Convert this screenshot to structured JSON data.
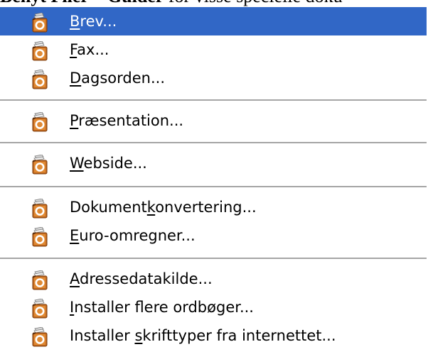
{
  "header_fragment": {
    "bold1": "Benyt",
    "bold2": "Filer",
    "dash": " – ",
    "bold3": "Guider",
    "rest": " for visse specielle doku"
  },
  "icon_name": "oo-wizard-icon",
  "colors": {
    "selection": "#3167c6",
    "separator": "#a5a5a5"
  },
  "menu": {
    "items": [
      {
        "key": "brev",
        "pre": "",
        "mnemonic": "B",
        "post": "rev...",
        "selected": true
      },
      {
        "key": "fax",
        "pre": "",
        "mnemonic": "F",
        "post": "ax...",
        "selected": false
      },
      {
        "key": "dagsorden",
        "pre": "",
        "mnemonic": "D",
        "post": "agsorden...",
        "selected": false
      },
      {
        "key": "praesentation",
        "pre": "",
        "mnemonic": "P",
        "post": "ræsentation...",
        "selected": false
      },
      {
        "key": "webside",
        "pre": "",
        "mnemonic": "W",
        "post": "ebside...",
        "selected": false
      },
      {
        "key": "dokumentkonvertering",
        "pre": "Dokument",
        "mnemonic": "k",
        "post": "onvertering...",
        "selected": false
      },
      {
        "key": "euro-omregner",
        "pre": "",
        "mnemonic": "E",
        "post": "uro-omregner...",
        "selected": false
      },
      {
        "key": "adressedatakilde",
        "pre": "",
        "mnemonic": "A",
        "post": "dressedatakilde...",
        "selected": false
      },
      {
        "key": "installer-ordboeger",
        "pre": "",
        "mnemonic": "I",
        "post": "nstaller flere ordbøger...",
        "selected": false
      },
      {
        "key": "installer-skrifttyper",
        "pre": "Installer ",
        "mnemonic": "s",
        "post": "krifttyper fra internettet...",
        "selected": false
      }
    ]
  }
}
